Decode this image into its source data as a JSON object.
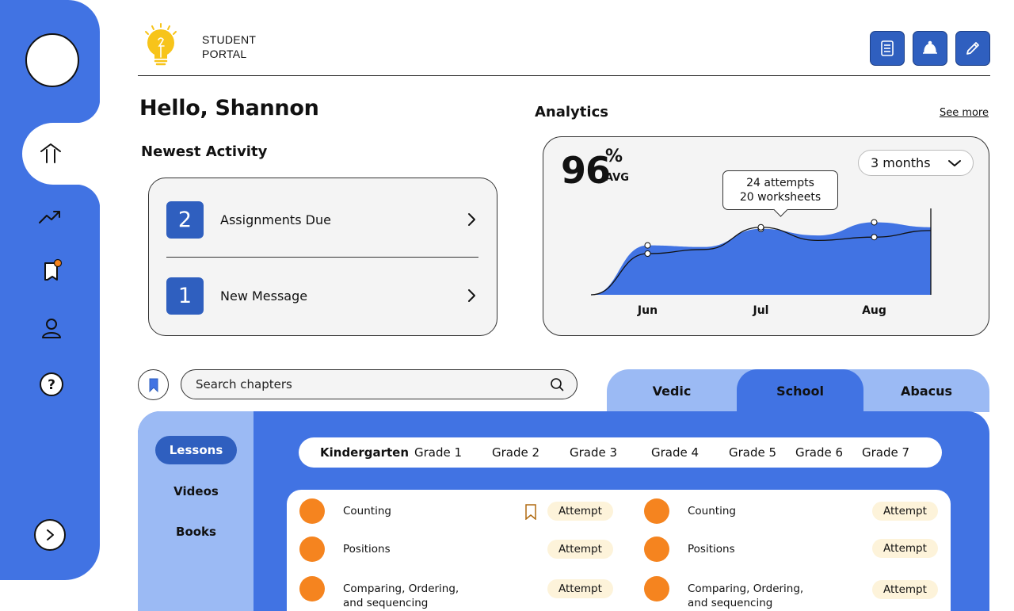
{
  "brand": {
    "line1": "STUDENT",
    "line2": "PORTAL"
  },
  "header": {
    "buttons": [
      {
        "icon": "notes-icon"
      },
      {
        "icon": "bell-icon"
      },
      {
        "icon": "pencil-icon"
      }
    ]
  },
  "sidebar": {
    "items": [
      {
        "icon": "home-icon",
        "active": true
      },
      {
        "icon": "trending-up-icon"
      },
      {
        "icon": "notes-notification-icon",
        "badge_color": "#f5841f"
      },
      {
        "icon": "user-icon"
      },
      {
        "icon": "help-icon"
      }
    ],
    "expand_icon": "chevron-right-icon"
  },
  "greeting": "Hello, Shannon",
  "activity": {
    "title": "Newest Activity",
    "items": [
      {
        "count": "2",
        "label": "Assignments Due"
      },
      {
        "count": "1",
        "label": "New Message"
      }
    ]
  },
  "analytics": {
    "title": "Analytics",
    "see_more": "See more",
    "avg_value": "96",
    "avg_unit": "%",
    "avg_label": "AVG",
    "range": "3 months",
    "tooltip": {
      "line1": "24 attempts",
      "line2": "20 worksheets"
    }
  },
  "chart_data": {
    "type": "area",
    "categories": [
      "Jun",
      "Jul",
      "Aug"
    ],
    "series": [
      {
        "values": [
          0,
          60,
          58,
          80,
          72,
          88,
          82
        ],
        "style": "area"
      },
      {
        "values": [
          0,
          50,
          55,
          82,
          66,
          70,
          78
        ],
        "style": "line"
      }
    ],
    "colors": {
      "area": "#4173e3",
      "line": "#111111"
    },
    "grid": false
  },
  "search": {
    "placeholder": "Search chapters"
  },
  "program_tabs": [
    {
      "label": "Vedic",
      "active": false
    },
    {
      "label": "School",
      "active": true
    },
    {
      "label": "Abacus",
      "active": false
    }
  ],
  "subnav": [
    {
      "label": "Lessons",
      "active": true
    },
    {
      "label": "Videos",
      "active": false
    },
    {
      "label": "Books",
      "active": false
    }
  ],
  "grades": [
    {
      "label": "Kindergarten",
      "active": true
    },
    {
      "label": "Grade 1"
    },
    {
      "label": "Grade 2"
    },
    {
      "label": "Grade 3"
    },
    {
      "label": "Grade 4"
    },
    {
      "label": "Grade 5"
    },
    {
      "label": "Grade 6"
    },
    {
      "label": "Grade 7"
    }
  ],
  "lessons": {
    "left": [
      {
        "name": "Counting",
        "action": "Attempt",
        "bookmarked": true
      },
      {
        "name": "Positions",
        "action": "Attempt"
      },
      {
        "name": "Comparing, Ordering,\nand sequencing",
        "action": "Attempt"
      }
    ],
    "right": [
      {
        "name": "Counting",
        "action": "Attempt"
      },
      {
        "name": "Positions",
        "action": "Attempt"
      },
      {
        "name": "Comparing, Ordering,\nand sequencing",
        "action": "Attempt"
      }
    ]
  },
  "colors": {
    "primary": "#4173e3",
    "primary_dark": "#2f5fbf",
    "light_blue": "#9bbaf4",
    "accent_orange": "#f5841f",
    "logo_yellow": "#f7c41a"
  }
}
